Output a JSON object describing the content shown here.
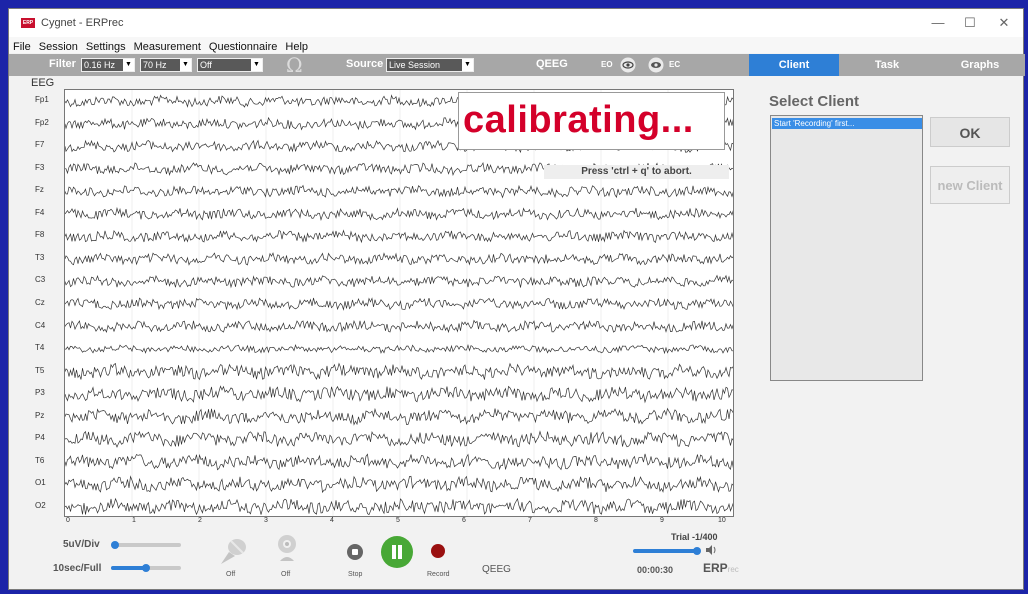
{
  "window": {
    "title": "Cygnet - ERPrec",
    "logo_text": "ERP",
    "controls": {
      "minimize": "—",
      "maximize": "☐",
      "close": "✕"
    }
  },
  "menu": [
    "File",
    "Session",
    "Settings",
    "Measurement",
    "Questionnaire",
    "Help"
  ],
  "toolbar": {
    "filter_label": "Filter",
    "filter_low": "0.16 Hz",
    "filter_high": "70 Hz",
    "notch": "Off",
    "source_label": "Source",
    "source_value": "Live Session",
    "qeeg_label": "QEEG",
    "eo_label": "EO",
    "ec_label": "EC"
  },
  "tabs": [
    {
      "label": "Client",
      "active": true
    },
    {
      "label": "Task",
      "active": false
    },
    {
      "label": "Graphs",
      "active": false
    }
  ],
  "eeg": {
    "title": "EEG",
    "channels": [
      "Fp1",
      "Fp2",
      "F7",
      "F3",
      "Fz",
      "F4",
      "F8",
      "T3",
      "C3",
      "Cz",
      "C4",
      "T4",
      "T5",
      "P3",
      "Pz",
      "P4",
      "T6",
      "O1",
      "O2"
    ],
    "x_ticks": [
      "0",
      "1",
      "2",
      "3",
      "4",
      "5",
      "6",
      "7",
      "8",
      "9",
      "10"
    ]
  },
  "overlay": {
    "calibrating": "calibrating...",
    "abort_hint": "Press 'ctrl + q' to abort."
  },
  "client": {
    "heading": "Select Client",
    "list_items": [
      "Start 'Recording' first..."
    ],
    "ok_label": "OK",
    "new_client_label": "new Client"
  },
  "bottom": {
    "scale_label": "5uV/Div",
    "time_label": "10sec/Full",
    "mic_status": "Off",
    "cam_status": "Off",
    "stop_label": "Stop",
    "record_label": "Record",
    "qeeg_label": "QEEG",
    "trial": "Trial -1/400",
    "elapsed": "00:00:30",
    "brand_main": "ERP",
    "brand_sub": "rec"
  },
  "colors": {
    "accent": "#2e7fd6",
    "calibrating_text": "#d4002a",
    "pause_button": "#48a836",
    "record_button": "#9a1010"
  }
}
